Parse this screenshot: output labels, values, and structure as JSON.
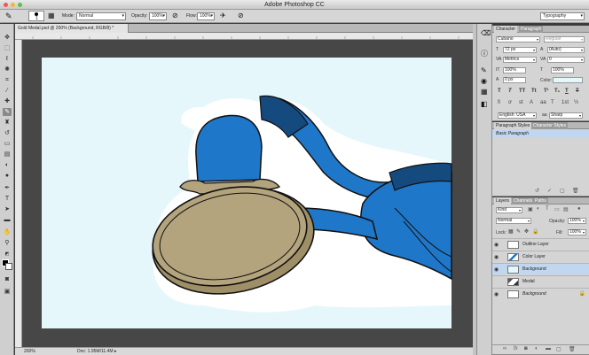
{
  "app": {
    "title": "Adobe Photoshop CC"
  },
  "options_bar": {
    "brush_size": "1",
    "mode_label": "Mode:",
    "mode_value": "Normal",
    "opacity_label": "Opacity:",
    "opacity_value": "100%",
    "flow_label": "Flow:",
    "flow_value": "100%",
    "workspace": "Typography"
  },
  "document": {
    "tab_title": "Gold Medal.psd @ 200% (Background, RGB/8) *",
    "zoom": "200%",
    "doc_info": "Doc: 1.95M/11.4M"
  },
  "colors": {
    "ribbon_blue": "#1f77c9",
    "ribbon_dark": "#144a7e",
    "medal_gold": "#b3a47d",
    "canvas_bg": "#e6f7fb",
    "selection": "#c1d6ef"
  },
  "character_panel": {
    "tabs": [
      "Character",
      "Paragraph"
    ],
    "font_family": "Cubano",
    "font_style": "Regular",
    "font_size": "72 px",
    "leading": "(Auto)",
    "kerning": "Metrics",
    "tracking": "0",
    "vertical_scale": "100%",
    "horizontal_scale": "100%",
    "baseline": "0 px",
    "color_label": "Color:",
    "type_buttons": [
      "T",
      "T",
      "TT",
      "Tt",
      "T¹",
      "T₁",
      "T",
      "T"
    ],
    "language": "English: USA",
    "antialias": "Sharp"
  },
  "styles_panel": {
    "tabs": [
      "Paragraph Styles",
      "Character Styles"
    ],
    "items": [
      "Basic Paragraph"
    ]
  },
  "layers_panel": {
    "tabs": [
      "Layers",
      "Channels",
      "Paths"
    ],
    "filter": "Kind",
    "blend_mode": "Normal",
    "opacity_label": "Opacity:",
    "opacity_value": "100%",
    "lock_label": "Lock:",
    "fill_label": "Fill:",
    "fill_value": "100%",
    "layers": [
      {
        "name": "Outline Layer",
        "visible": true,
        "selected": false,
        "italic": false
      },
      {
        "name": "Color Layer",
        "visible": true,
        "selected": false,
        "italic": false
      },
      {
        "name": "Background",
        "visible": true,
        "selected": true,
        "italic": false
      },
      {
        "name": "Medal",
        "visible": false,
        "selected": false,
        "italic": false
      },
      {
        "name": "Background",
        "visible": true,
        "selected": false,
        "italic": true
      }
    ]
  }
}
